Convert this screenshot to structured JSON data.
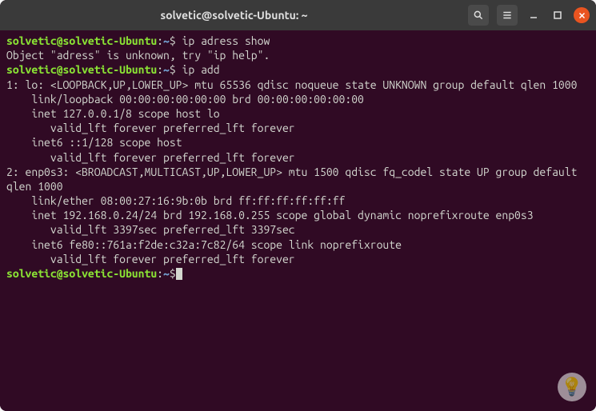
{
  "titlebar": {
    "title": "solvetic@solvetic-Ubuntu: ~"
  },
  "prompt": {
    "user_host": "solvetic@solvetic-Ubuntu",
    "colon": ":",
    "path": "~",
    "dollar": "$"
  },
  "lines": {
    "cmd1": " ip adress show",
    "out1": "Object \"adress\" is unknown, try \"ip help\".",
    "cmd2": " ip add",
    "out2": "1: lo: <LOOPBACK,UP,LOWER_UP> mtu 65536 qdisc noqueue state UNKNOWN group default qlen 1000",
    "out3": "    link/loopback 00:00:00:00:00:00 brd 00:00:00:00:00:00",
    "out4": "    inet 127.0.0.1/8 scope host lo",
    "out5": "       valid_lft forever preferred_lft forever",
    "out6": "    inet6 ::1/128 scope host ",
    "out7": "       valid_lft forever preferred_lft forever",
    "out8": "2: enp0s3: <BROADCAST,MULTICAST,UP,LOWER_UP> mtu 1500 qdisc fq_codel state UP group default qlen 1000",
    "out9": "    link/ether 08:00:27:16:9b:0b brd ff:ff:ff:ff:ff:ff",
    "out10": "    inet 192.168.0.24/24 brd 192.168.0.255 scope global dynamic noprefixroute enp0s3",
    "out11": "       valid_lft 3397sec preferred_lft 3397sec",
    "out12": "    inet6 fe80::761a:f2de:c32a:7c82/64 scope link noprefixroute ",
    "out13": "       valid_lft forever preferred_lft forever"
  }
}
